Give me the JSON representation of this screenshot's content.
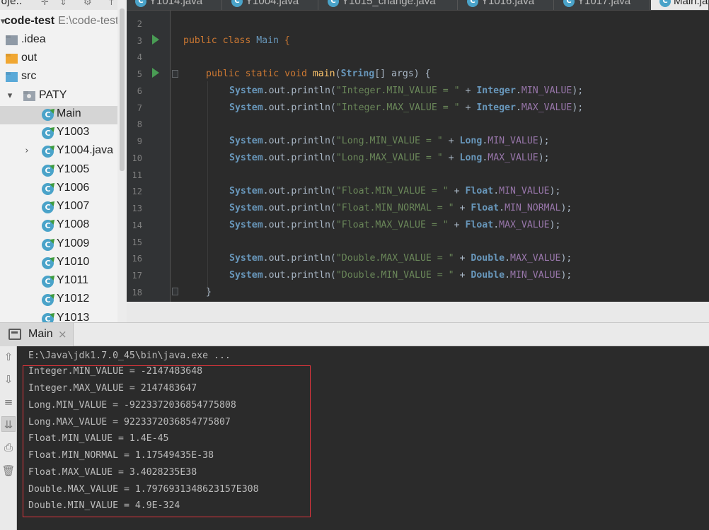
{
  "sidebar": {
    "toolbar_title": "roje..",
    "root": {
      "name": "code-test",
      "path": "E:\\code-test"
    },
    "items": [
      {
        "label": ".idea",
        "icon": "folder-icon",
        "level": 0
      },
      {
        "label": "out",
        "icon": "folder-icon",
        "level": 0
      },
      {
        "label": "src",
        "icon": "source-folder-icon",
        "level": 0
      },
      {
        "label": "PATY",
        "icon": "package-icon",
        "level": 1
      },
      {
        "label": "Main",
        "icon": "class-icon",
        "level": 2,
        "selected": true
      },
      {
        "label": "Y1003",
        "icon": "class-icon",
        "level": 2
      },
      {
        "label": "Y1004.java",
        "icon": "class-icon",
        "level": 2
      },
      {
        "label": "Y1005",
        "icon": "class-icon",
        "level": 2
      },
      {
        "label": "Y1006",
        "icon": "class-icon",
        "level": 2
      },
      {
        "label": "Y1007",
        "icon": "class-icon",
        "level": 2
      },
      {
        "label": "Y1008",
        "icon": "class-icon",
        "level": 2
      },
      {
        "label": "Y1009",
        "icon": "class-icon",
        "level": 2
      },
      {
        "label": "Y1010",
        "icon": "class-icon",
        "level": 2
      },
      {
        "label": "Y1011",
        "icon": "class-icon",
        "level": 2
      },
      {
        "label": "Y1012",
        "icon": "class-icon",
        "level": 2
      },
      {
        "label": "Y1013",
        "icon": "class-icon",
        "level": 2
      }
    ]
  },
  "editor_tabs": [
    {
      "label": "Y1014.java"
    },
    {
      "label": "Y1004.java"
    },
    {
      "label": "Y1015_change.java"
    },
    {
      "label": "Y1016.java"
    },
    {
      "label": "Y1017.java"
    },
    {
      "label": "Main.java",
      "active": true
    }
  ],
  "editor": {
    "line_numbers": [
      "2",
      "3",
      "4",
      "5",
      "6",
      "7",
      "8",
      "9",
      "10",
      "11",
      "12",
      "13",
      "14",
      "15",
      "16",
      "17",
      "18"
    ],
    "code": {
      "class_decl": {
        "kw": "public class ",
        "name": "Main",
        "brace": " {"
      },
      "main_decl": {
        "kw": "public static void ",
        "fn": "main",
        "params_open": "(",
        "type": "String",
        "params_rest": "[] args) {"
      },
      "prints": [
        {
          "line": 6,
          "str": "\"Integer.MIN_VALUE = \"",
          "cls": "Integer",
          "fld": "MIN_VALUE"
        },
        {
          "line": 7,
          "str": "\"Integer.MAX_VALUE = \"",
          "cls": "Integer",
          "fld": "MAX_VALUE"
        },
        {
          "line": 9,
          "str": "\"Long.MIN_VALUE = \"",
          "cls": "Long",
          "fld": "MIN_VALUE"
        },
        {
          "line": 10,
          "str": "\"Long.MAX_VALUE = \"",
          "cls": "Long",
          "fld": "MAX_VALUE"
        },
        {
          "line": 12,
          "str": "\"Float.MIN_VALUE = \"",
          "cls": "Float",
          "fld": "MIN_VALUE"
        },
        {
          "line": 13,
          "str": "\"Float.MIN_NORMAL = \"",
          "cls": "Float",
          "fld": "MIN_NORMAL"
        },
        {
          "line": 14,
          "str": "\"Float.MAX_VALUE = \"",
          "cls": "Float",
          "fld": "MAX_VALUE"
        },
        {
          "line": 16,
          "str": "\"Double.MAX_VALUE = \"",
          "cls": "Double",
          "fld": "MAX_VALUE"
        },
        {
          "line": 17,
          "str": "\"Double.MIN_VALUE = \"",
          "cls": "Double",
          "fld": "MIN_VALUE"
        }
      ],
      "system": "System",
      "out_call": ".out.println(",
      "plus": " + ",
      "dot": ".",
      "close": ");",
      "closing_brace": "}"
    }
  },
  "run_panel": {
    "tab_label": "Main",
    "close_glyph": "×",
    "command": "E:\\Java\\jdk1.7.0_45\\bin\\java.exe ...",
    "output": [
      "Integer.MIN_VALUE = -2147483648",
      "Integer.MAX_VALUE = 2147483647",
      "Long.MIN_VALUE = -9223372036854775808",
      "Long.MAX_VALUE = 9223372036854775807",
      "Float.MIN_VALUE = 1.4E-45",
      "Float.MIN_NORMAL = 1.17549435E-38",
      "Float.MAX_VALUE = 3.4028235E38",
      "Double.MAX_VALUE = 1.7976931348623157E308",
      "Double.MIN_VALUE = 4.9E-324"
    ],
    "highlight_color": "#e0343c"
  }
}
